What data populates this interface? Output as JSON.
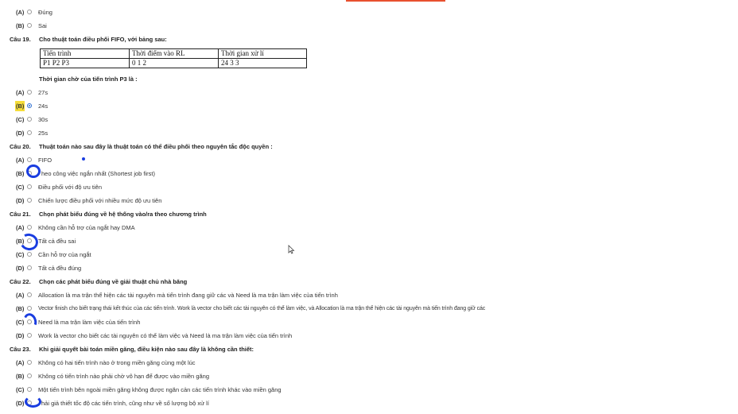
{
  "q18_options": [
    {
      "letter": "(A)",
      "text": "Đúng"
    },
    {
      "letter": "(B)",
      "text": "Sai"
    }
  ],
  "q19": {
    "number": "Câu 19.",
    "question": "Cho thuật toán điều phối FIFO, với bảng sau:",
    "table": {
      "headers": [
        "Tiến trình",
        "Thời điểm vào RL",
        "Thời gian xử lí"
      ],
      "row": [
        "P1 P2 P3",
        "0 1 2",
        "24 3 3"
      ]
    },
    "subquestion": "Thời gian chờ của tiến trình P3 là :",
    "options": [
      {
        "letter": "(A)",
        "text": "27s"
      },
      {
        "letter": "(B)",
        "text": "24s"
      },
      {
        "letter": "(C)",
        "text": "30s"
      },
      {
        "letter": "(D)",
        "text": "25s"
      }
    ]
  },
  "q20": {
    "number": "Câu 20.",
    "question": "Thuật toán nào sau đây là thuật toán có thể điều phối theo nguyên tắc độc quyền :",
    "options": [
      {
        "letter": "(A)",
        "text": "FIFO"
      },
      {
        "letter": "(B)",
        "text": "heo công việc ngắn nhất (Shortest job first)"
      },
      {
        "letter": "(C)",
        "text": "Điều phối với độ ưu tiên"
      },
      {
        "letter": "(D)",
        "text": "Chiến lược điều phối với nhiều mức độ ưu tiên"
      }
    ]
  },
  "q21": {
    "number": "Câu 21.",
    "question": "Chọn phát biểu đúng về hệ thống vào/ra theo chương trình",
    "options": [
      {
        "letter": "(A)",
        "text": "Không cần hỗ trợ của ngắt hay DMA"
      },
      {
        "letter": "(B)",
        "text": "Tất cả đều sai"
      },
      {
        "letter": "(C)",
        "text": "Cần hỗ trợ của ngắt"
      },
      {
        "letter": "(D)",
        "text": "Tất cả đều đúng"
      }
    ]
  },
  "q22": {
    "number": "Câu 22.",
    "question": "Chọn các phát biểu đúng về giải thuật chủ nhà băng",
    "options": [
      {
        "letter": "(A)",
        "text": "Allocation là ma trận thể hiện các tài nguyên mà tiến trình đang giữ các và Need là ma trận làm việc của tiến trình"
      },
      {
        "letter": "(B)",
        "text": "Vector finish cho biết trạng thái kết thúc của các tiến trình. Work là vector cho biết các tài nguyên có thể làm việc, và Allocation là ma trận thể hiện các tài nguyên mà tiến trình đang giữ các"
      },
      {
        "letter": "(C)",
        "text": "Need là ma trận làm việc của tiến trình"
      },
      {
        "letter": "(D)",
        "text": "Work là vector cho biết các tài nguyên có thể làm việc và Need là ma trận làm việc của tiến trình"
      }
    ]
  },
  "q23": {
    "number": "Câu 23.",
    "question": "Khi giải quyết bài toán miền găng, điều kiện nào sau đây là không cần thiết:",
    "options": [
      {
        "letter": "(A)",
        "text": "Không có hai tiến trình nào ở trong miền găng cùng một lúc"
      },
      {
        "letter": "(B)",
        "text": "Không có tiến trình nào phải chờ vô hạn để được vào miền găng"
      },
      {
        "letter": "(C)",
        "text": "Một tiến trình bên ngoài miền găng không được ngăn cản các tiến trình khác vào miền găng"
      },
      {
        "letter": "(D)",
        "text": "hải giả thiết tốc độ các tiến trình, cũng như về số lượng bộ xử lí"
      }
    ]
  },
  "colors": {
    "highlight": "#f5dd3a",
    "radio_selected": "#2b6ed1",
    "pen_mark": "#1a3de0",
    "top_bar": "#e8502f"
  }
}
